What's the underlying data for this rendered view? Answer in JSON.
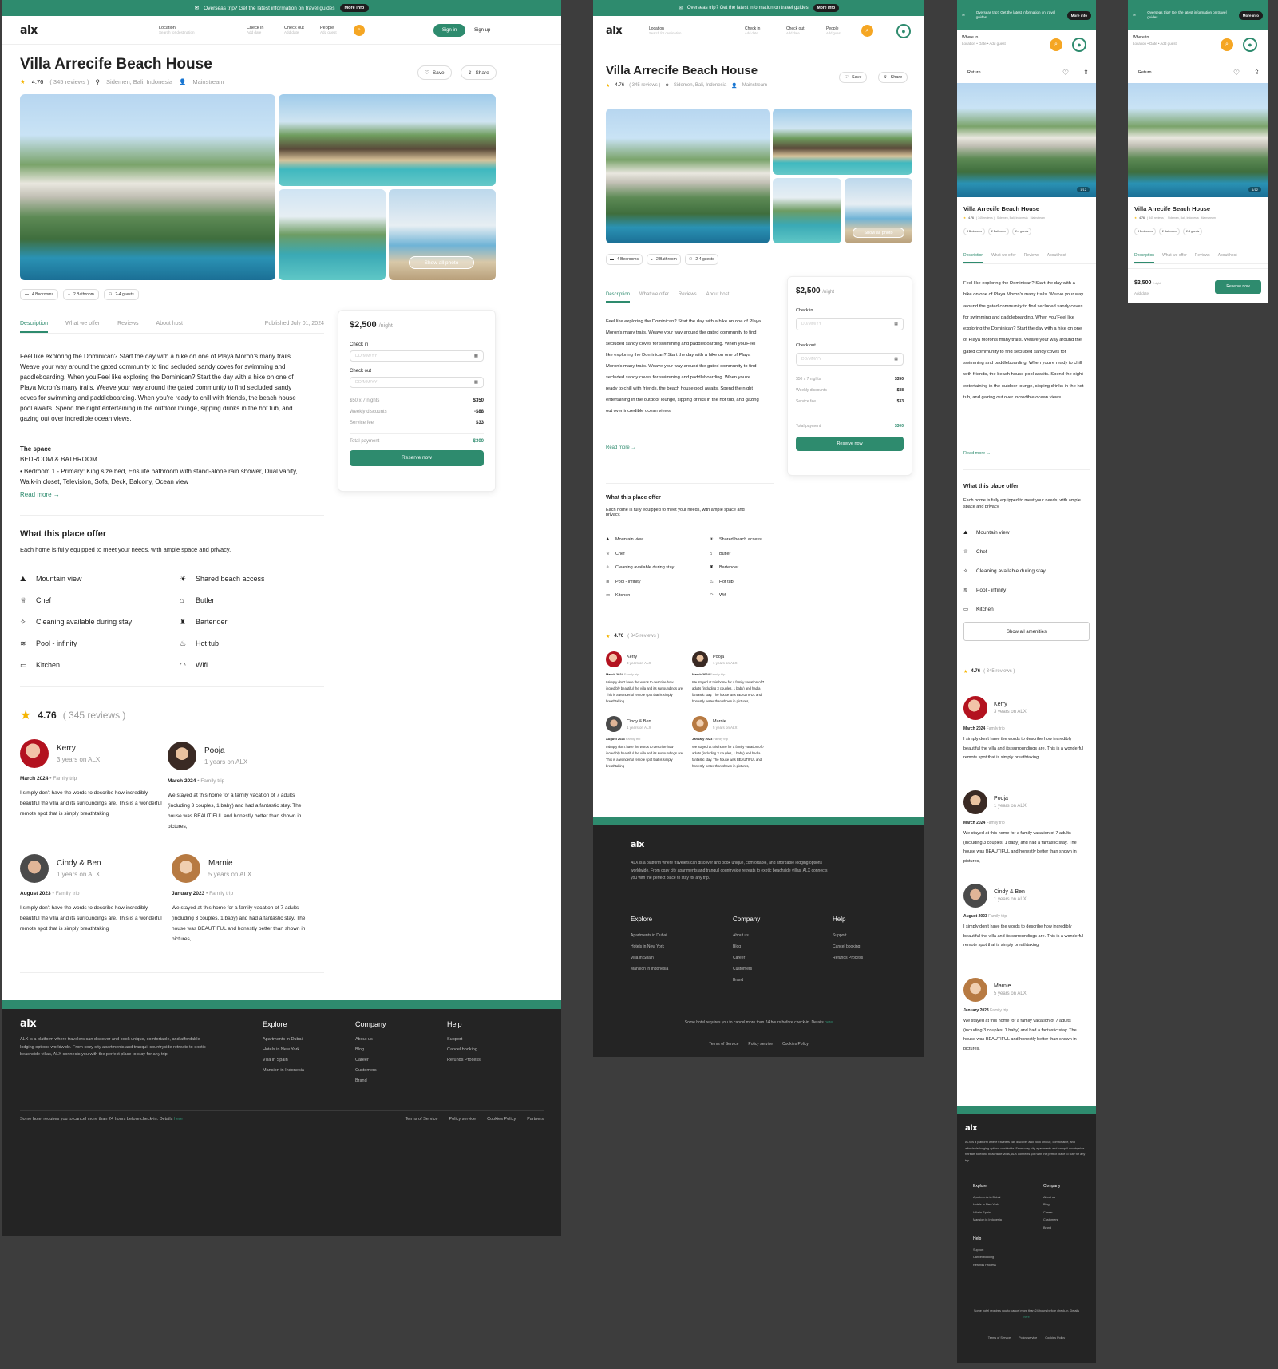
{
  "banner": {
    "text": "Overseas trip? Get the latest information on travel guides",
    "pill": "More info"
  },
  "nav": {
    "logo": "alx",
    "location_label": "Location",
    "location_placeholder": "Search for destination",
    "checkin_label": "Check in",
    "checkin_placeholder": "Add date",
    "checkout_label": "Check out",
    "checkout_placeholder": "Add date",
    "people_label": "People",
    "people_placeholder": "Add guest",
    "signin": "Sign in",
    "signup": "Sign up",
    "where_label": "Where to",
    "where_placeholder": "Location • Date • Add guest"
  },
  "listing": {
    "title": "Villa Arrecife Beach House",
    "rating": "4.76",
    "reviews": "( 345 reviews )",
    "location": "Sidemen, Bali, Indonesia",
    "host_type": "Mainstream",
    "save": "Save",
    "share": "Share",
    "return": "Return",
    "show_all_photo": "Show all photo",
    "photo_counter": "1/12",
    "chips": [
      "4 Bedrooms",
      "2 Bathroom",
      "2-4 guests"
    ],
    "tabs": [
      "Description",
      "What we offer",
      "Reviews",
      "About host"
    ],
    "published": "Published July 01, 2024",
    "description": "Feel like exploring the Dominican? Start the day with a hike on one of Playa Moron's many trails. Weave your way around the gated community to find secluded sandy coves for swimming and paddleboarding. When you'Feel like exploring the Dominican? Start the day with a hike on one of Playa Moron's many trails. Weave your way around the gated community to find secluded sandy coves for swimming and paddleboarding. When you're ready to chill with friends, the beach house pool awaits. Spend the night entertaining in the outdoor lounge, sipping drinks in the hot tub, and gazing out over incredible ocean views.",
    "space_title": "The space",
    "space_sub": "BEDROOM & BATHROOM",
    "space_text": "• Bedroom 1 - Primary: King size bed, Ensuite bathroom with stand-alone rain shower, Dual vanity, Walk-in closet, Television, Sofa, Deck, Balcony, Ocean view",
    "read_more": "Read more"
  },
  "booking": {
    "price": "$2,500",
    "per": "/night",
    "checkin": "Check in",
    "checkout": "Check out",
    "date_placeholder": "DD/MM/YY",
    "lines": [
      {
        "label": "$50 x 7 nights",
        "value": "$350"
      },
      {
        "label": "Weekly discounts",
        "value": "-$88"
      },
      {
        "label": "Service fee",
        "value": "$33"
      }
    ],
    "total_label": "Total payment",
    "total_value": "$300",
    "reserve": "Reserve now",
    "add_date": "Add date"
  },
  "amenities": {
    "title": "What this place offer",
    "subtitle": "Each home is fully equipped to meet your needs, with ample space and privacy.",
    "left": [
      "Mountain view",
      "Chef",
      "Cleaning available during stay",
      "Pool - infinity",
      "Kitchen"
    ],
    "right": [
      "Shared beach access",
      "Butler",
      "Bartender",
      "Hot tub",
      "Wifi"
    ],
    "show_all": "Show all amenities"
  },
  "reviews": {
    "rating": "4.76",
    "count": "( 345 reviews )",
    "items": [
      {
        "name": "Kerry",
        "tenure": "3 years on ALX",
        "date": "March 2024",
        "trip": "Family trip",
        "text": "I simply don't have the words to describe how incredibly beautiful the villa and its surroundings are. This is a wonderful remote spot that is simply breathtaking"
      },
      {
        "name": "Pooja",
        "tenure": "1 years on ALX",
        "date": "March 2024",
        "trip": "Family trip",
        "text": "We stayed at this home for a family vacation of 7 adults (including 3 couples, 1 baby) and had a fantastic stay. The house was BEAUTIFUL and honestly better than shown in pictures,"
      },
      {
        "name": "Cindy & Ben",
        "tenure": "1 years on ALX",
        "date": "August 2023",
        "trip": "Family trip",
        "text": "I simply don't have the words to describe how incredibly beautiful the villa and its surroundings are. This is a wonderful remote spot that is simply breathtaking"
      },
      {
        "name": "Marnie",
        "tenure": "5 years on ALX",
        "date": "January 2023",
        "trip": "Family trip",
        "text": "We stayed at this home for a family vacation of 7 adults (including 3 couples, 1 baby) and had a fantastic stay. The house was BEAUTIFUL and honestly better than shown in pictures,"
      }
    ]
  },
  "footer": {
    "logo": "alx",
    "about": "ALX is a platform where travelers can discover and book unique, comfortable, and affordable lodging options worldwide. From cozy city apartments and tranquil countryside retreats to exotic beachside villas, ALX connects you with the perfect place to stay for any trip.",
    "explore_title": "Explore",
    "explore": [
      "Apartments in Dubai",
      "Hotels in New York",
      "Villa in Spain",
      "Mansion in Indonesia"
    ],
    "company_title": "Company",
    "company": [
      "About us",
      "Blog",
      "Career",
      "Customers",
      "Brand"
    ],
    "help_title": "Help",
    "help": [
      "Support",
      "Cancel booking",
      "Refunds Process"
    ],
    "notice": "Some hotel requires you to cancel more than 24 hours before check-in. Details",
    "notice_link": "here",
    "legal": [
      "Terms of Service",
      "Policy service",
      "Cookies Policy",
      "Partners"
    ]
  }
}
